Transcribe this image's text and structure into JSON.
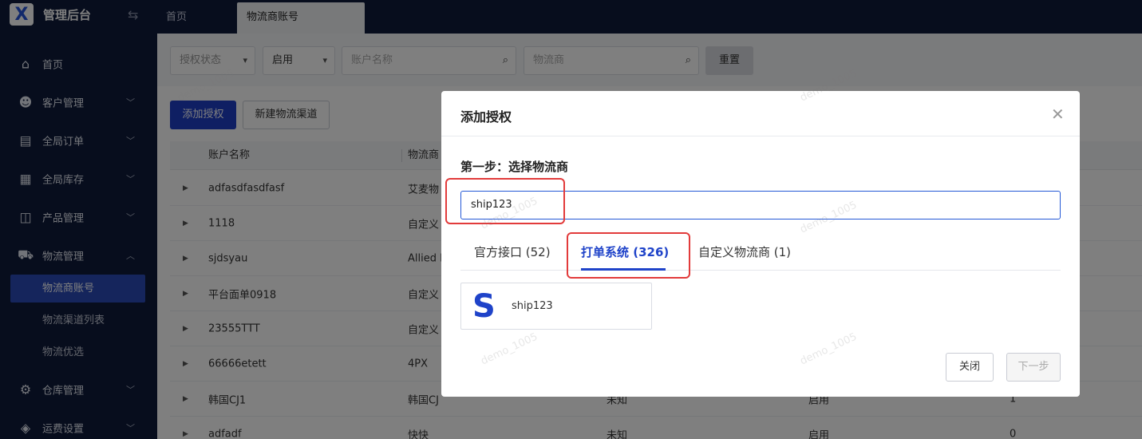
{
  "app": {
    "title": "管理后台",
    "logo_letter": "X"
  },
  "tabs": [
    {
      "label": "首页"
    },
    {
      "label": "物流商账号"
    }
  ],
  "sidebar": {
    "items": [
      {
        "label": "首页"
      },
      {
        "label": "客户管理"
      },
      {
        "label": "全局订单"
      },
      {
        "label": "全局库存"
      },
      {
        "label": "产品管理"
      },
      {
        "label": "物流管理"
      },
      {
        "label": "仓库管理"
      },
      {
        "label": "运费设置"
      }
    ],
    "sub_items": [
      {
        "label": "物流商账号"
      },
      {
        "label": "物流渠道列表"
      },
      {
        "label": "物流优选"
      }
    ]
  },
  "filters": {
    "auth_status_placeholder": "授权状态",
    "enabled_value": "启用",
    "account_placeholder": "账户名称",
    "carrier_placeholder": "物流商",
    "reset_label": "重置"
  },
  "actions": {
    "add_auth_label": "添加授权",
    "new_channel_label": "新建物流渠道"
  },
  "table": {
    "headers": {
      "account": "账户名称",
      "carrier": "物流商"
    },
    "rows": [
      {
        "account": "adfasdfasdfasf",
        "carrier": "艾麦物",
        "status": "",
        "enabled": "",
        "count": ""
      },
      {
        "account": "1118",
        "carrier": "自定义",
        "status": "",
        "enabled": "",
        "count": ""
      },
      {
        "account": "sjdsyau",
        "carrier": "Allied E",
        "status": "",
        "enabled": "",
        "count": ""
      },
      {
        "account": "平台面单0918",
        "carrier": "自定义",
        "status": "",
        "enabled": "",
        "count": ""
      },
      {
        "account": "23555TTT",
        "carrier": "自定义",
        "status": "",
        "enabled": "",
        "count": ""
      },
      {
        "account": "66666etett",
        "carrier": "4PX",
        "status": "",
        "enabled": "",
        "count": ""
      },
      {
        "account": "韩国CJ1",
        "carrier": "韩国CJ",
        "status": "未知",
        "enabled": "启用",
        "count": "1"
      },
      {
        "account": "adfadf",
        "carrier": "快快",
        "status": "未知",
        "enabled": "启用",
        "count": "0"
      }
    ]
  },
  "modal": {
    "title": "添加授权",
    "step_label": "第一步：选择物流商",
    "search_value": "ship123",
    "tabs": [
      {
        "label": "官方接口 (52)"
      },
      {
        "label": "打单系统 (326)"
      },
      {
        "label": "自定义物流商 (1)"
      }
    ],
    "result_card": {
      "logo_letter": "S",
      "name": "ship123"
    },
    "close_label": "关闭",
    "next_label": "下一步"
  },
  "watermark": "demo_1005",
  "colors": {
    "sidebar_bg": "#0f1a3a",
    "primary": "#1f43c9",
    "highlight_box": "#e23b3b"
  }
}
